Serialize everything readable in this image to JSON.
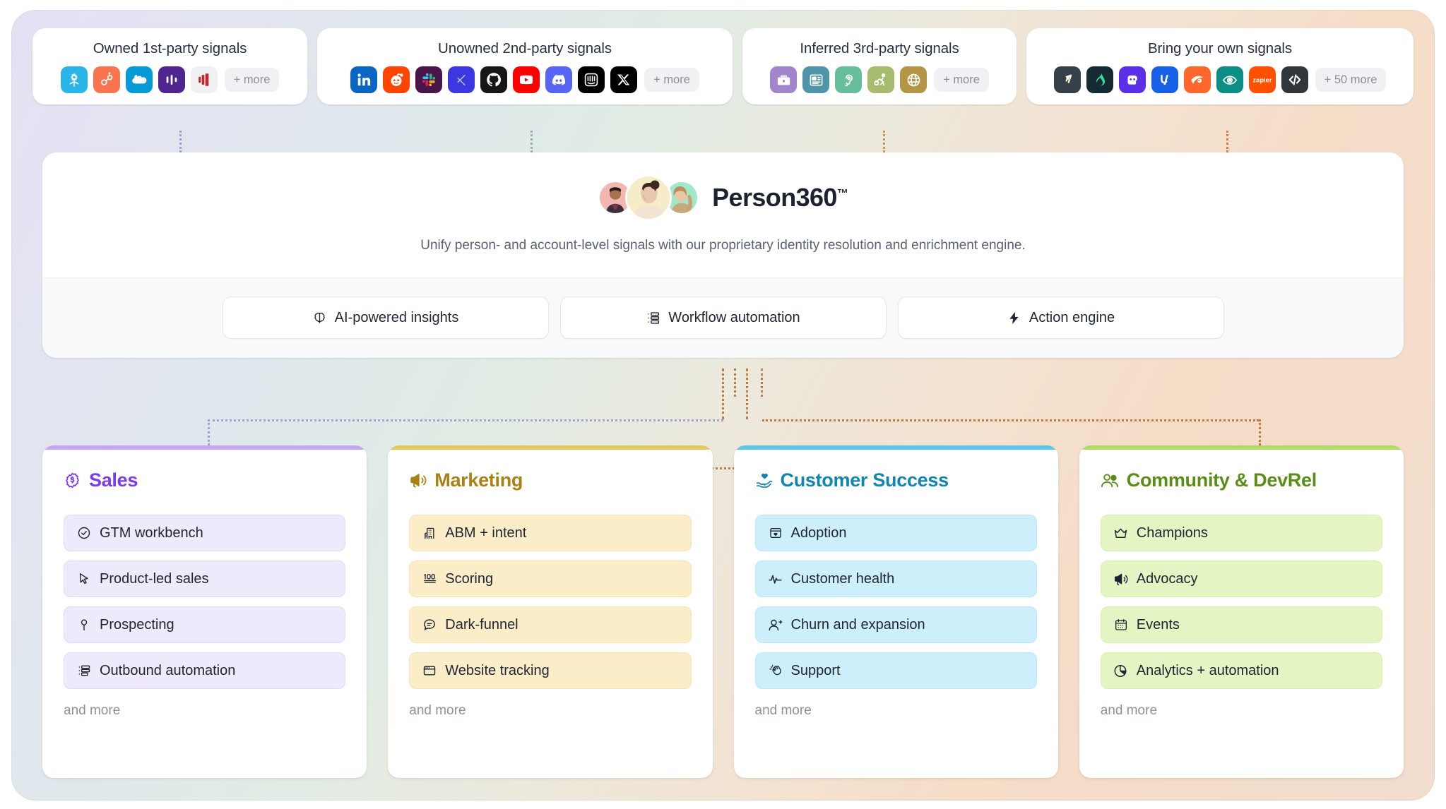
{
  "signal_cards": [
    {
      "title": "Owned 1st-party signals",
      "more_label": "+ more",
      "logos": [
        {
          "name": "snowflake-logo",
          "bg": "#29b5e8"
        },
        {
          "name": "hubspot-logo",
          "bg": "#f8754f"
        },
        {
          "name": "salesforce-logo",
          "bg": "#069ad6"
        },
        {
          "name": "amplitude-logo",
          "bg": "#51258f"
        },
        {
          "name": "marketo-logo",
          "bg": "#f1f1f3"
        }
      ]
    },
    {
      "title": "Unowned 2nd-party signals",
      "more_label": "+ more",
      "logos": [
        {
          "name": "linkedin-logo",
          "bg": "#0a66c2"
        },
        {
          "name": "reddit-logo",
          "bg": "#ff4500"
        },
        {
          "name": "slack-logo",
          "bg": "#4a154b"
        },
        {
          "name": "kaggle-logo",
          "bg": "#3c37e0"
        },
        {
          "name": "github-logo",
          "bg": "#181717"
        },
        {
          "name": "youtube-logo",
          "bg": "#ff0000"
        },
        {
          "name": "discord-logo",
          "bg": "#5865f2"
        },
        {
          "name": "intercom-logo",
          "bg": "#000000"
        },
        {
          "name": "x-twitter-logo",
          "bg": "#000000"
        }
      ]
    },
    {
      "title": "Inferred 3rd-party signals",
      "more_label": "+ more",
      "logos": [
        {
          "name": "briefcase-icon",
          "bg": "#a285cd"
        },
        {
          "name": "newspaper-icon",
          "bg": "#4e95aa"
        },
        {
          "name": "ear-listening-icon",
          "bg": "#66bd9a"
        },
        {
          "name": "traveler-icon",
          "bg": "#a7bb6e"
        },
        {
          "name": "globe-icon",
          "bg": "#b49646"
        }
      ]
    },
    {
      "title": "Bring your own signals",
      "more_label": "+ 50 more",
      "logos": [
        {
          "name": "datadog-logo",
          "bg": "#36404a"
        },
        {
          "name": "gleap-logo",
          "bg": "#152b33"
        },
        {
          "name": "datagrail-logo",
          "bg": "#5b2fe8"
        },
        {
          "name": "typeform-logo",
          "bg": "#1661e8"
        },
        {
          "name": "semrush-logo",
          "bg": "#ff662b"
        },
        {
          "name": "hotjar-logo",
          "bg": "#0c8e84"
        },
        {
          "name": "zapier-logo",
          "bg": "#ff4f00"
        },
        {
          "name": "custom-code-logo",
          "bg": "#31363b"
        }
      ]
    }
  ],
  "hub": {
    "title": "Person360",
    "trademark": "™",
    "subtitle": "Unify person- and account-level signals with our proprietary identity resolution and enrichment engine.",
    "capabilities": [
      {
        "label": "AI-powered insights",
        "icon": "brain-icon"
      },
      {
        "label": "Workflow automation",
        "icon": "workflow-icon"
      },
      {
        "label": "Action engine",
        "icon": "lightning-bolt-icon"
      }
    ]
  },
  "teams": [
    {
      "name": "Sales",
      "icon": "money-badge-icon",
      "accent": "#7c3aed",
      "bar": "#c4a6f5",
      "chip_bg": "#efe9fc",
      "chip_border": "#e2d8f8",
      "items": [
        {
          "label": "GTM workbench",
          "icon": "check-circle-icon"
        },
        {
          "label": "Product-led sales",
          "icon": "cursor-icon"
        },
        {
          "label": "Prospecting",
          "icon": "map-pin-icon"
        },
        {
          "label": "Outbound automation",
          "icon": "list-flow-icon"
        }
      ],
      "and_more": "and more"
    },
    {
      "name": "Marketing",
      "icon": "megaphone-icon",
      "accent": "#a88213",
      "bar": "#e1c85b",
      "chip_bg": "#fbedc7",
      "chip_border": "#f6e3b4",
      "items": [
        {
          "label": "ABM + intent",
          "icon": "building-icon"
        },
        {
          "label": "Scoring",
          "icon": "hundred-points-icon"
        },
        {
          "label": "Dark-funnel",
          "icon": "chat-bubble-icon"
        },
        {
          "label": "Website tracking",
          "icon": "browser-window-icon"
        }
      ],
      "and_more": "and more"
    },
    {
      "name": "Customer Success",
      "icon": "heart-hand-icon",
      "accent": "#0e86ad",
      "bar": "#57c6e8",
      "chip_bg": "#cdeffb",
      "chip_border": "#bbe8f8",
      "items": [
        {
          "label": "Adoption",
          "icon": "package-heart-icon"
        },
        {
          "label": "Customer health",
          "icon": "pulse-icon"
        },
        {
          "label": "Churn and expansion",
          "icon": "user-plus-icon"
        },
        {
          "label": "Support",
          "icon": "waving-hand-icon"
        }
      ],
      "and_more": "and more"
    },
    {
      "name": "Community & DevRel",
      "icon": "people-group-icon",
      "accent": "#5a8d13",
      "bar": "#b2db63",
      "chip_bg": "#e5f4c3",
      "chip_border": "#dcefb1",
      "items": [
        {
          "label": "Champions",
          "icon": "crown-icon"
        },
        {
          "label": "Advocacy",
          "icon": "megaphone-icon"
        },
        {
          "label": "Events",
          "icon": "calendar-icon"
        },
        {
          "label": "Analytics + automation",
          "icon": "pie-chart-icon"
        }
      ],
      "and_more": "and more"
    }
  ]
}
